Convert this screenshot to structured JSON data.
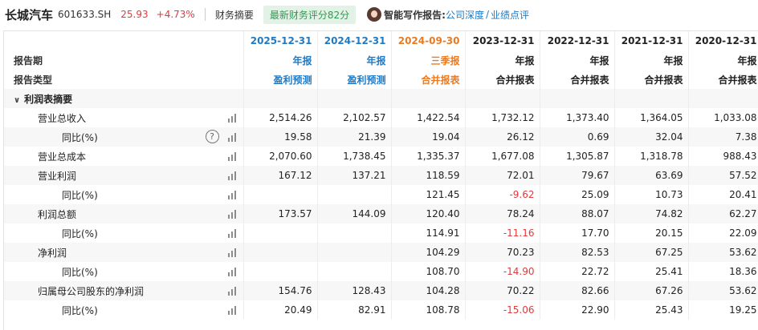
{
  "header": {
    "stock_name": "长城汽车",
    "stock_code": "601633.SH",
    "price": "25.93",
    "change": "+4.73%",
    "tab_label": "财务摘要",
    "score_badge": "最新财务评分82分",
    "ai_label": "智能写作报告:",
    "ai_link_1": "公司深度",
    "ai_sep": "/",
    "ai_link_2": "业绩点评",
    "icons": [
      "avatar",
      "help-icon",
      "bar-chart-icon",
      "chevron-down-icon"
    ]
  },
  "colors": {
    "up_red": "#e4393c",
    "forecast_blue": "#1f7bc6",
    "quarter_orange": "#ec7a1f",
    "score_green": "#2f9a4f"
  },
  "table": {
    "row_labels": {
      "period": "报告期",
      "type": "报告类型",
      "section": "利润表摘要"
    },
    "columns": [
      {
        "date": "2025-12-31",
        "period": "年报",
        "type": "盈利预测",
        "style": "forecast"
      },
      {
        "date": "2024-12-31",
        "period": "年报",
        "type": "盈利预测",
        "style": "forecast"
      },
      {
        "date": "2024-09-30",
        "period": "三季报",
        "type": "合并报表",
        "style": "quarter"
      },
      {
        "date": "2023-12-31",
        "period": "年报",
        "type": "合并报表",
        "style": "normal"
      },
      {
        "date": "2022-12-31",
        "period": "年报",
        "type": "合并报表",
        "style": "normal"
      },
      {
        "date": "2021-12-31",
        "period": "年报",
        "type": "合并报表",
        "style": "normal"
      },
      {
        "date": "2020-12-31",
        "period": "年报",
        "type": "合并报表",
        "style": "normal"
      }
    ],
    "rows": [
      {
        "label": "营业总收入",
        "level": 1,
        "help": false,
        "values": [
          "2,514.26",
          "2,102.57",
          "1,422.54",
          "1,732.12",
          "1,373.40",
          "1,364.05",
          "1,033.08"
        ]
      },
      {
        "label": "同比(%)",
        "level": 2,
        "help": true,
        "values": [
          "19.58",
          "21.39",
          "19.04",
          "26.12",
          "0.69",
          "32.04",
          "7.38"
        ]
      },
      {
        "label": "营业总成本",
        "level": 1,
        "help": false,
        "values": [
          "2,070.60",
          "1,738.45",
          "1,335.37",
          "1,677.08",
          "1,305.87",
          "1,318.78",
          "988.43"
        ]
      },
      {
        "label": "营业利润",
        "level": 1,
        "help": false,
        "values": [
          "167.12",
          "137.21",
          "118.59",
          "72.01",
          "79.67",
          "63.69",
          "57.52"
        ]
      },
      {
        "label": "同比(%)",
        "level": 2,
        "help": false,
        "values": [
          "",
          "",
          "121.45",
          "-9.62",
          "25.09",
          "10.73",
          "20.41"
        ]
      },
      {
        "label": "利润总额",
        "level": 1,
        "help": false,
        "values": [
          "173.57",
          "144.09",
          "120.40",
          "78.24",
          "88.07",
          "74.82",
          "62.27"
        ]
      },
      {
        "label": "同比(%)",
        "level": 2,
        "help": false,
        "values": [
          "",
          "",
          "114.91",
          "-11.16",
          "17.70",
          "20.15",
          "22.09"
        ]
      },
      {
        "label": "净利润",
        "level": 1,
        "help": false,
        "values": [
          "",
          "",
          "104.29",
          "70.23",
          "82.53",
          "67.25",
          "53.62"
        ]
      },
      {
        "label": "同比(%)",
        "level": 2,
        "help": false,
        "values": [
          "",
          "",
          "108.70",
          "-14.90",
          "22.72",
          "25.41",
          "18.36"
        ]
      },
      {
        "label": "归属母公司股东的净利润",
        "level": 1,
        "help": false,
        "values": [
          "154.76",
          "128.43",
          "104.28",
          "70.22",
          "82.66",
          "67.26",
          "53.62"
        ]
      },
      {
        "label": "同比(%)",
        "level": 2,
        "help": false,
        "values": [
          "20.49",
          "82.91",
          "108.78",
          "-15.06",
          "22.90",
          "25.43",
          "19.25"
        ]
      }
    ]
  }
}
